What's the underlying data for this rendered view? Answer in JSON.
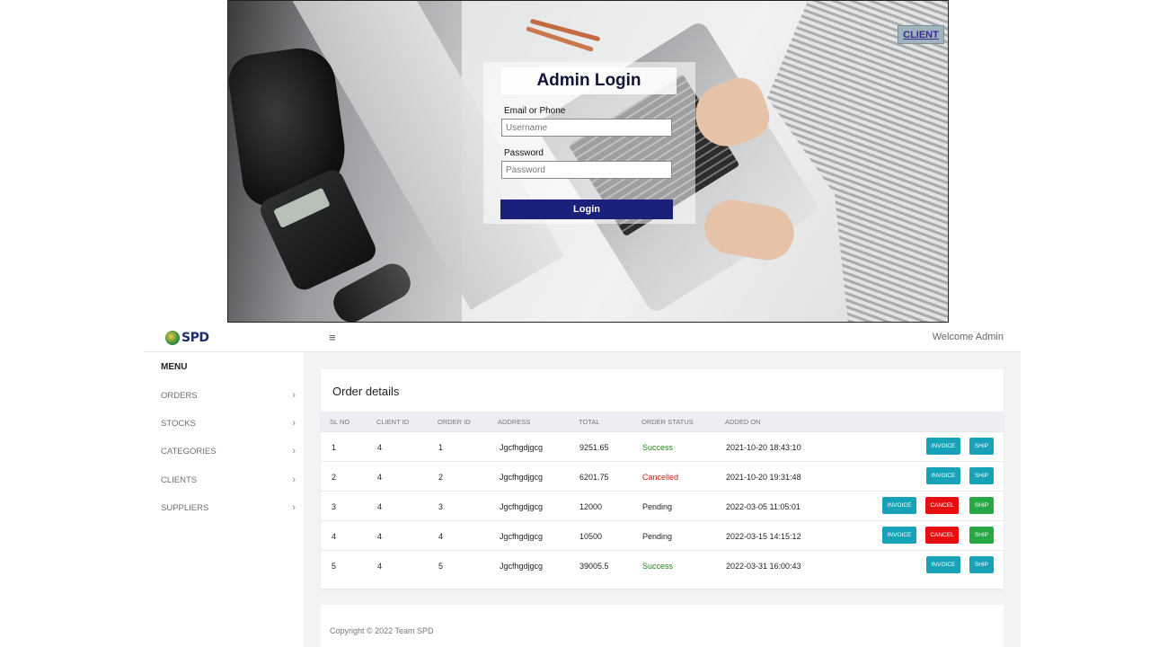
{
  "login": {
    "client_link": "CLIENT",
    "title": "Admin Login",
    "email_label": "Email or Phone",
    "email_placeholder": "Username",
    "password_label": "Password",
    "password_placeholder": "Password",
    "login_button": "Login"
  },
  "header": {
    "logo_text": "SPD",
    "menu_icon": "hamburger-icon",
    "welcome": "Welcome Admin"
  },
  "sidebar": {
    "title": "MENU",
    "items": [
      {
        "label": "ORDERS",
        "icon": "chevron-right-icon"
      },
      {
        "label": "STOCKS",
        "icon": "chevron-right-icon"
      },
      {
        "label": "CATEGORIES",
        "icon": "chevron-right-icon"
      },
      {
        "label": "CLIENTS",
        "icon": "chevron-right-icon"
      },
      {
        "label": "SUPPLIERS",
        "icon": "chevron-right-icon"
      }
    ]
  },
  "orders": {
    "title": "Order details",
    "columns": [
      "SL NO",
      "CLIENT ID",
      "ORDER ID",
      "ADDRESS",
      "TOTAL",
      "ORDER STATUS",
      "ADDED ON"
    ],
    "rows": [
      {
        "sl": "1",
        "client": "4",
        "order": "1",
        "address": "Jgcfhgdjgcg",
        "total": "9251.65",
        "status": "Success",
        "added": "2021-10-20 18:43:10"
      },
      {
        "sl": "2",
        "client": "4",
        "order": "2",
        "address": "Jgcfhgdjgcg",
        "total": "6201.75",
        "status": "Cancelled",
        "added": "2021-10-20 19:31:48"
      },
      {
        "sl": "3",
        "client": "4",
        "order": "3",
        "address": "Jgcfhgdjgcg",
        "total": "12000",
        "status": "Pending",
        "added": "2022-03-05 11:05:01"
      },
      {
        "sl": "4",
        "client": "4",
        "order": "4",
        "address": "Jgcfhgdjgcg",
        "total": "10500",
        "status": "Pending",
        "added": "2022-03-15 14:15:12"
      },
      {
        "sl": "5",
        "client": "4",
        "order": "5",
        "address": "Jgcfhgdjgcg",
        "total": "39005.5",
        "status": "Success",
        "added": "2022-03-31 16:00:43"
      }
    ],
    "buttons": {
      "invoice": "INVOICE",
      "cancel": "CANCEL",
      "ship": "SHIP"
    }
  },
  "colors": {
    "success": "#1a8a1a",
    "cancelled": "#c9171a",
    "info_button": "#17a2b8",
    "cancel_button": "#e80d10",
    "ship_button_pending": "#28a745",
    "login_button": "#1b217a"
  },
  "footer": {
    "text": "Copyright © 2022 Team SPD"
  }
}
